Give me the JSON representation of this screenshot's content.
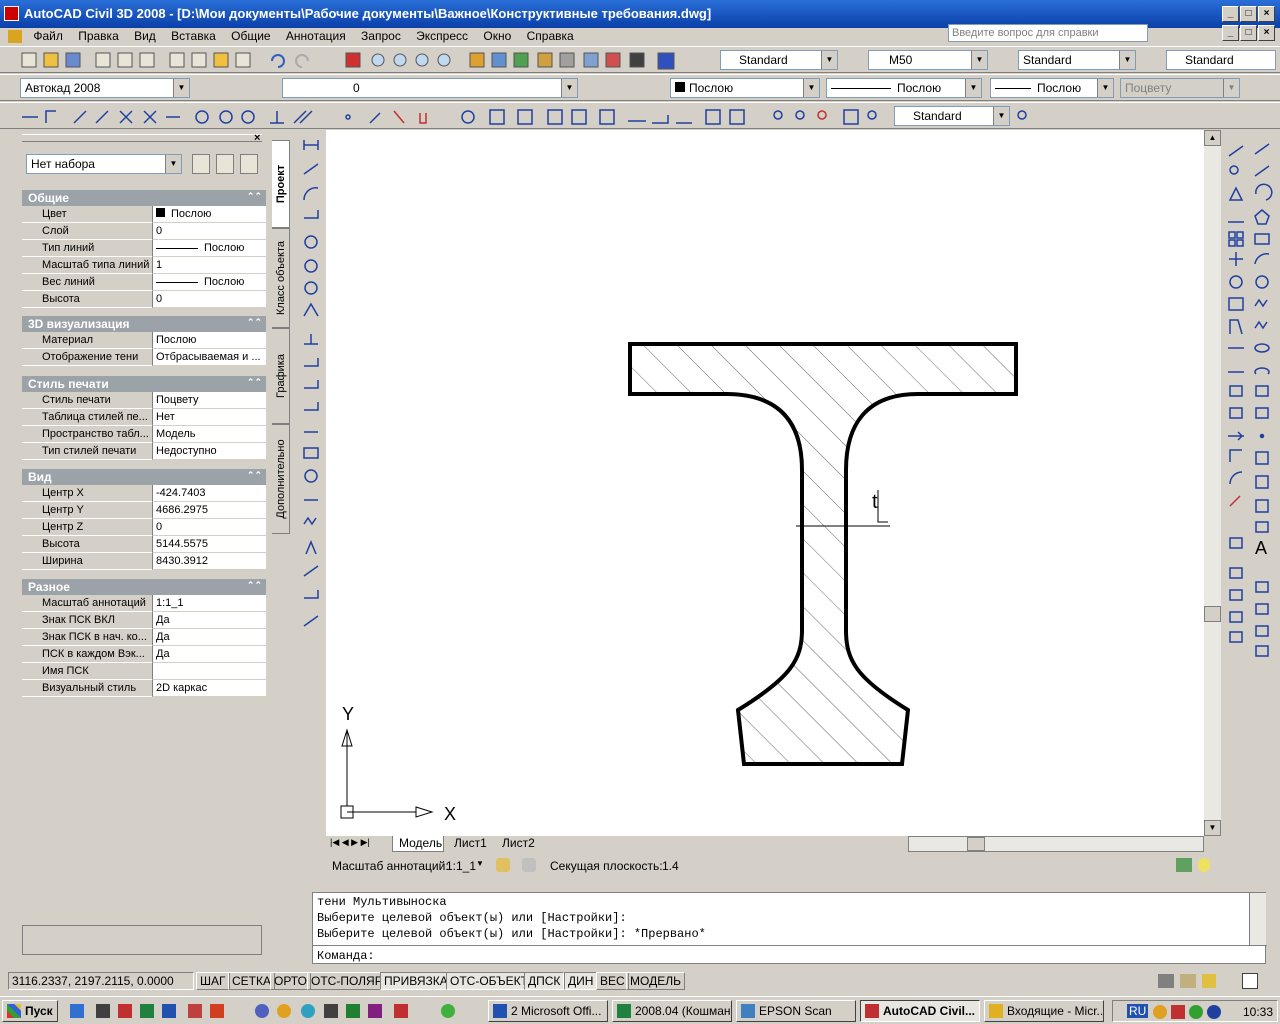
{
  "titlebar": {
    "title": "AutoCAD Civil 3D 2008 - [D:\\Мои документы\\Рабочие документы\\Важное\\Конструктивные требования.dwg]"
  },
  "menu": [
    "Файл",
    "Правка",
    "Вид",
    "Вставка",
    "Общие",
    "Аннотация",
    "Запрос",
    "Экспресс",
    "Окно",
    "Справка"
  ],
  "help_search": {
    "placeholder": "Введите вопрос для справки"
  },
  "styles": {
    "text_style": "Standard",
    "dim_style": "M50",
    "table_style": "Standard",
    "mleader_style": "Standard",
    "dim_style2": "Standard"
  },
  "workspace": "Автокад 2008",
  "layer": "0",
  "color": "Послою",
  "linetype": "Послою",
  "lineweight": "Послою",
  "plotstyle": "Поцвету",
  "properties": {
    "selection": "Нет набора",
    "sections": [
      {
        "title": "Общие",
        "rows": [
          {
            "k": "Цвет",
            "v": "Послою"
          },
          {
            "k": "Слой",
            "v": "0"
          },
          {
            "k": "Тип линий",
            "v": "Послою"
          },
          {
            "k": "Масштаб типа линий",
            "v": "1"
          },
          {
            "k": "Вес линий",
            "v": "Послою"
          },
          {
            "k": "Высота",
            "v": "0"
          }
        ]
      },
      {
        "title": "3D визуализация",
        "rows": [
          {
            "k": "Материал",
            "v": "Послою"
          },
          {
            "k": "Отображение тени",
            "v": "Отбрасываемая и ..."
          }
        ]
      },
      {
        "title": "Стиль печати",
        "rows": [
          {
            "k": "Стиль печати",
            "v": "Поцвету"
          },
          {
            "k": "Таблица стилей пе...",
            "v": "Нет"
          },
          {
            "k": "Пространство табл...",
            "v": "Модель"
          },
          {
            "k": "Тип стилей печати",
            "v": "Недоступно"
          }
        ]
      },
      {
        "title": "Вид",
        "rows": [
          {
            "k": "Центр X",
            "v": "-424.7403"
          },
          {
            "k": "Центр Y",
            "v": "4686.2975"
          },
          {
            "k": "Центр Z",
            "v": "0"
          },
          {
            "k": "Высота",
            "v": "5144.5575"
          },
          {
            "k": "Ширина",
            "v": "8430.3912"
          }
        ]
      },
      {
        "title": "Разное",
        "rows": [
          {
            "k": "Масштаб аннотаций",
            "v": "1:1_1"
          },
          {
            "k": "Знак ПСК ВКЛ",
            "v": "Да"
          },
          {
            "k": "Знак ПСК в нач. ко...",
            "v": "Да"
          },
          {
            "k": "ПСК в каждом Вэк...",
            "v": "Да"
          },
          {
            "k": "Имя ПСК",
            "v": ""
          },
          {
            "k": "Визуальный стиль",
            "v": "2D каркас"
          }
        ]
      }
    ]
  },
  "side_tabs": [
    "Проект",
    "Класс объекта",
    "Графика",
    "Дополнительно"
  ],
  "drawing": {
    "axis_y": "Y",
    "axis_x": "X",
    "label_t": "t"
  },
  "layout_tabs": [
    "Модель",
    "Лист1",
    "Лист2"
  ],
  "annotation": {
    "scale_label": "Масштаб аннотаций:",
    "scale_value": "1:1_1",
    "section_label": "Секущая плоскость:",
    "section_value": "1.4"
  },
  "command_lines": [
    "тени Мультивыноска",
    "Выберите целевой объект(ы) или [Настройки]:",
    "Выберите целевой объект(ы) или [Настройки]: *Прервано*"
  ],
  "command_prompt": "Команда:",
  "status": {
    "coords": "3116.2337, 2197.2115, 0.0000",
    "toggles": [
      "ШАГ",
      "СЕТКА",
      "ОРТО",
      "ОТС-ПОЛЯР",
      "ПРИВЯЗКА",
      "ОТС-ОБЪЕКТ",
      "ДПСК",
      "ДИН",
      "ВЕС",
      "МОДЕЛЬ"
    ]
  },
  "taskbar": {
    "start": "Пуск",
    "tasks": [
      "2 Microsoft Offi...",
      "2008.04 (Кошман)",
      "EPSON Scan",
      "AutoCAD Civil...",
      "Входящие - Micr..."
    ],
    "lang": "RU",
    "clock": "10:33"
  },
  "colors": {
    "title_blue": "#0a3fa8",
    "section_gray": "#9ba3a9",
    "panel": "#d4d0c8"
  }
}
